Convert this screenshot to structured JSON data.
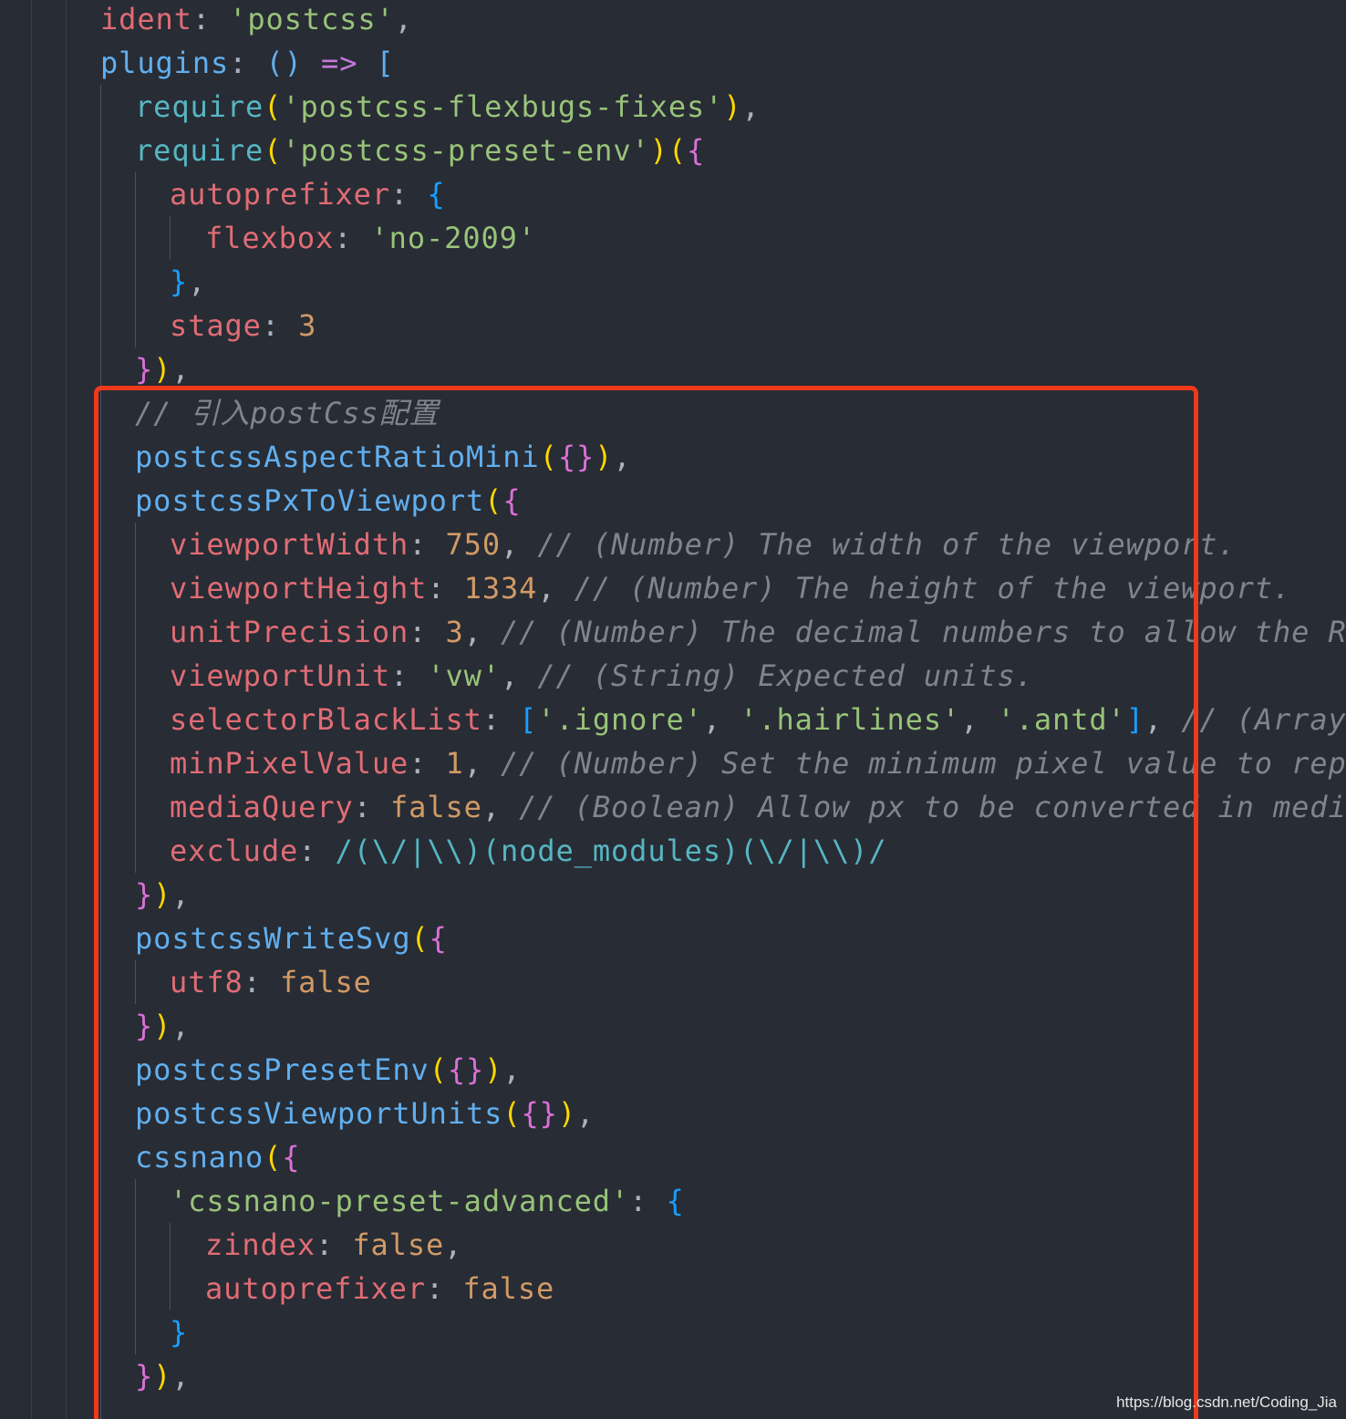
{
  "colors": {
    "background": "#282c34",
    "property": "#e06c75",
    "string": "#98c379",
    "function": "#61afef",
    "builtin": "#56b6c2",
    "number": "#d19a66",
    "keyword": "#c678dd",
    "punctuation": "#abb2bf",
    "comment": "#7f848e",
    "bracket_gold": "#ffd700",
    "bracket_pink": "#da70d6",
    "bracket_blue": "#179fff",
    "highlight_box": "#f0391c"
  },
  "lines": [
    [
      [
        "ident",
        "property"
      ],
      [
        ": ",
        "punctuation"
      ],
      [
        "'postcss'",
        "string"
      ],
      [
        ",",
        "punctuation"
      ]
    ],
    [
      [
        "plugins",
        "function"
      ],
      [
        ": ",
        "punctuation"
      ],
      [
        "()",
        "function"
      ],
      [
        " ",
        "punctuation"
      ],
      [
        "=>",
        "keyword"
      ],
      [
        " ",
        "punctuation"
      ],
      [
        "[",
        "function"
      ]
    ],
    [
      [
        "require",
        "builtin"
      ],
      [
        "(",
        "bracket_gold"
      ],
      [
        "'postcss-flexbugs-fixes'",
        "string"
      ],
      [
        ")",
        "bracket_gold"
      ],
      [
        ",",
        "punctuation"
      ]
    ],
    [
      [
        "require",
        "builtin"
      ],
      [
        "(",
        "bracket_gold"
      ],
      [
        "'postcss-preset-env'",
        "string"
      ],
      [
        ")",
        "bracket_gold"
      ],
      [
        "(",
        "bracket_gold"
      ],
      [
        "{",
        "bracket_pink"
      ]
    ],
    [
      [
        "autoprefixer",
        "property"
      ],
      [
        ": ",
        "punctuation"
      ],
      [
        "{",
        "bracket_blue"
      ]
    ],
    [
      [
        "flexbox",
        "property"
      ],
      [
        ": ",
        "punctuation"
      ],
      [
        "'no-2009'",
        "string"
      ]
    ],
    [
      [
        "}",
        "bracket_blue"
      ],
      [
        ",",
        "punctuation"
      ]
    ],
    [
      [
        "stage",
        "property"
      ],
      [
        ": ",
        "punctuation"
      ],
      [
        "3",
        "number"
      ]
    ],
    [
      [
        "}",
        "bracket_pink"
      ],
      [
        ")",
        "bracket_gold"
      ],
      [
        ",",
        "punctuation"
      ]
    ],
    [
      [
        "// 引入postCss配置",
        "comment"
      ]
    ],
    [
      [
        "postcssAspectRatioMini",
        "function"
      ],
      [
        "(",
        "bracket_gold"
      ],
      [
        "{}",
        "bracket_pink"
      ],
      [
        ")",
        "bracket_gold"
      ],
      [
        ",",
        "punctuation"
      ]
    ],
    [
      [
        "postcssPxToViewport",
        "function"
      ],
      [
        "(",
        "bracket_gold"
      ],
      [
        "{",
        "bracket_pink"
      ]
    ],
    [
      [
        "viewportWidth",
        "property"
      ],
      [
        ": ",
        "punctuation"
      ],
      [
        "750",
        "number"
      ],
      [
        ", ",
        "punctuation"
      ],
      [
        "// (Number) The width of the viewport.",
        "comment"
      ]
    ],
    [
      [
        "viewportHeight",
        "property"
      ],
      [
        ": ",
        "punctuation"
      ],
      [
        "1334",
        "number"
      ],
      [
        ", ",
        "punctuation"
      ],
      [
        "// (Number) The height of the viewport.",
        "comment"
      ]
    ],
    [
      [
        "unitPrecision",
        "property"
      ],
      [
        ": ",
        "punctuation"
      ],
      [
        "3",
        "number"
      ],
      [
        ", ",
        "punctuation"
      ],
      [
        "// (Number) The decimal numbers to allow the REM",
        "comment"
      ]
    ],
    [
      [
        "viewportUnit",
        "property"
      ],
      [
        ": ",
        "punctuation"
      ],
      [
        "'vw'",
        "string"
      ],
      [
        ", ",
        "punctuation"
      ],
      [
        "// (String) Expected units.",
        "comment"
      ]
    ],
    [
      [
        "selectorBlackList",
        "property"
      ],
      [
        ": ",
        "punctuation"
      ],
      [
        "[",
        "bracket_blue"
      ],
      [
        "'.ignore'",
        "string"
      ],
      [
        ", ",
        "punctuation"
      ],
      [
        "'.hairlines'",
        "string"
      ],
      [
        ", ",
        "punctuation"
      ],
      [
        "'.antd'",
        "string"
      ],
      [
        "]",
        "bracket_blue"
      ],
      [
        ", ",
        "punctuation"
      ],
      [
        "// (Array) T",
        "comment"
      ]
    ],
    [
      [
        "minPixelValue",
        "property"
      ],
      [
        ": ",
        "punctuation"
      ],
      [
        "1",
        "number"
      ],
      [
        ", ",
        "punctuation"
      ],
      [
        "// (Number) Set the minimum pixel value to replac",
        "comment"
      ]
    ],
    [
      [
        "mediaQuery",
        "property"
      ],
      [
        ": ",
        "punctuation"
      ],
      [
        "false",
        "number"
      ],
      [
        ", ",
        "punctuation"
      ],
      [
        "// (Boolean) Allow px to be converted in media q",
        "comment"
      ]
    ],
    [
      [
        "exclude",
        "property"
      ],
      [
        ": ",
        "punctuation"
      ],
      [
        "/(\\/|\\\\)(node_modules)(\\/|\\\\)/",
        "builtin"
      ]
    ],
    [
      [
        "}",
        "bracket_pink"
      ],
      [
        ")",
        "bracket_gold"
      ],
      [
        ",",
        "punctuation"
      ]
    ],
    [
      [
        "postcssWriteSvg",
        "function"
      ],
      [
        "(",
        "bracket_gold"
      ],
      [
        "{",
        "bracket_pink"
      ]
    ],
    [
      [
        "utf8",
        "property"
      ],
      [
        ": ",
        "punctuation"
      ],
      [
        "false",
        "number"
      ]
    ],
    [
      [
        "}",
        "bracket_pink"
      ],
      [
        ")",
        "bracket_gold"
      ],
      [
        ",",
        "punctuation"
      ]
    ],
    [
      [
        "postcssPresetEnv",
        "function"
      ],
      [
        "(",
        "bracket_gold"
      ],
      [
        "{}",
        "bracket_pink"
      ],
      [
        ")",
        "bracket_gold"
      ],
      [
        ",",
        "punctuation"
      ]
    ],
    [
      [
        "postcssViewportUnits",
        "function"
      ],
      [
        "(",
        "bracket_gold"
      ],
      [
        "{}",
        "bracket_pink"
      ],
      [
        ")",
        "bracket_gold"
      ],
      [
        ",",
        "punctuation"
      ]
    ],
    [
      [
        "cssnano",
        "function"
      ],
      [
        "(",
        "bracket_gold"
      ],
      [
        "{",
        "bracket_pink"
      ]
    ],
    [
      [
        "'cssnano-preset-advanced'",
        "string"
      ],
      [
        ": ",
        "punctuation"
      ],
      [
        "{",
        "bracket_blue"
      ]
    ],
    [
      [
        "zindex",
        "property"
      ],
      [
        ": ",
        "punctuation"
      ],
      [
        "false",
        "number"
      ],
      [
        ",",
        "punctuation"
      ]
    ],
    [
      [
        "autoprefixer",
        "property"
      ],
      [
        ": ",
        "punctuation"
      ],
      [
        "false",
        "number"
      ]
    ],
    [
      [
        "}",
        "bracket_blue"
      ]
    ],
    [
      [
        "}",
        "bracket_pink"
      ],
      [
        ")",
        "bracket_gold"
      ],
      [
        ",",
        "punctuation"
      ]
    ]
  ],
  "watermark": "https://blog.csdn.net/Coding_Jia"
}
